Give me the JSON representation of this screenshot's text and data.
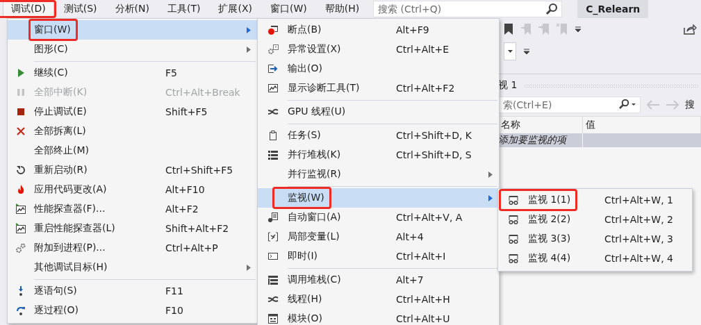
{
  "menubar": {
    "items": [
      {
        "label": "调试(D)",
        "selected": true,
        "annotated": true
      },
      {
        "label": "测试(S)",
        "selected": false,
        "annotated": false
      },
      {
        "label": "分析(N)",
        "selected": false,
        "annotated": false
      },
      {
        "label": "工具(T)",
        "selected": false,
        "annotated": false
      },
      {
        "label": "扩展(X)",
        "selected": false,
        "annotated": false
      },
      {
        "label": "窗口(W)",
        "selected": false,
        "annotated": false
      },
      {
        "label": "帮助(H)",
        "selected": false,
        "annotated": false
      }
    ],
    "search": {
      "placeholder": "搜索 (Ctrl+Q)"
    },
    "solution": "C_Relearn"
  },
  "watch_panel": {
    "title": "视 1",
    "search": {
      "placeholder": "索(Ctrl+E)"
    },
    "search_depth_label": "搜",
    "columns": [
      "名称",
      "值"
    ],
    "rows": [
      {
        "name": "添加要监视的项"
      }
    ]
  },
  "debug_menu": {
    "items": [
      {
        "kind": "item",
        "label": "窗口(W)",
        "has_submenu": true,
        "selected": true,
        "disabled": false,
        "annotated": true
      },
      {
        "kind": "item",
        "label": "图形(C)",
        "has_submenu": true,
        "selected": false,
        "disabled": false,
        "annotated": false
      },
      {
        "kind": "separator"
      },
      {
        "kind": "item",
        "label": "继续(C)",
        "shortcut": "F5",
        "has_submenu": false,
        "selected": false,
        "disabled": false,
        "annotated": false
      },
      {
        "kind": "item",
        "label": "全部中断(K)",
        "shortcut": "Ctrl+Alt+Break",
        "has_submenu": false,
        "selected": false,
        "disabled": true,
        "annotated": false
      },
      {
        "kind": "item",
        "label": "停止调试(E)",
        "shortcut": "Shift+F5",
        "has_submenu": false,
        "selected": false,
        "disabled": false,
        "annotated": false
      },
      {
        "kind": "item",
        "label": "全部拆离(L)",
        "has_submenu": false,
        "selected": false,
        "disabled": false,
        "annotated": false
      },
      {
        "kind": "item",
        "label": "全部终止(M)",
        "has_submenu": false,
        "selected": false,
        "disabled": false,
        "annotated": false
      },
      {
        "kind": "item",
        "label": "重新启动(R)",
        "shortcut": "Ctrl+Shift+F5",
        "has_submenu": false,
        "selected": false,
        "disabled": false,
        "annotated": false
      },
      {
        "kind": "item",
        "label": "应用代码更改(A)",
        "shortcut": "Alt+F10",
        "has_submenu": false,
        "selected": false,
        "disabled": false,
        "annotated": false
      },
      {
        "kind": "item",
        "label": "性能探查器(F)...",
        "shortcut": "Alt+F2",
        "has_submenu": false,
        "selected": false,
        "disabled": false,
        "annotated": false
      },
      {
        "kind": "item",
        "label": "重启性能探查器(L)",
        "shortcut": "Shift+Alt+F2",
        "has_submenu": false,
        "selected": false,
        "disabled": false,
        "annotated": false
      },
      {
        "kind": "item",
        "label": "附加到进程(P)...",
        "shortcut": "Ctrl+Alt+P",
        "has_submenu": false,
        "selected": false,
        "disabled": false,
        "annotated": false
      },
      {
        "kind": "item",
        "label": "其他调试目标(H)",
        "has_submenu": true,
        "selected": false,
        "disabled": false,
        "annotated": false
      },
      {
        "kind": "separator"
      },
      {
        "kind": "item",
        "label": "逐语句(S)",
        "shortcut": "F11",
        "has_submenu": false,
        "selected": false,
        "disabled": false,
        "annotated": false
      },
      {
        "kind": "item",
        "label": "逐过程(O)",
        "shortcut": "F10",
        "has_submenu": false,
        "selected": false,
        "disabled": false,
        "annotated": false
      }
    ]
  },
  "window_menu": {
    "items": [
      {
        "kind": "item",
        "label": "断点(B)",
        "shortcut": "Alt+F9",
        "has_submenu": false,
        "selected": false,
        "disabled": false,
        "annotated": false
      },
      {
        "kind": "item",
        "label": "异常设置(X)",
        "shortcut": "Ctrl+Alt+E",
        "has_submenu": false,
        "selected": false,
        "disabled": false,
        "annotated": false
      },
      {
        "kind": "item",
        "label": "输出(O)",
        "has_submenu": false,
        "selected": false,
        "disabled": false,
        "annotated": false
      },
      {
        "kind": "item",
        "label": "显示诊断工具(T)",
        "shortcut": "Ctrl+Alt+F2",
        "has_submenu": false,
        "selected": false,
        "disabled": false,
        "annotated": false
      },
      {
        "kind": "separator"
      },
      {
        "kind": "item",
        "label": "GPU 线程(U)",
        "has_submenu": false,
        "selected": false,
        "disabled": false,
        "annotated": false
      },
      {
        "kind": "separator"
      },
      {
        "kind": "item",
        "label": "任务(S)",
        "shortcut": "Ctrl+Shift+D, K",
        "has_submenu": false,
        "selected": false,
        "disabled": false,
        "annotated": false
      },
      {
        "kind": "item",
        "label": "并行堆栈(K)",
        "shortcut": "Ctrl+Shift+D, S",
        "has_submenu": false,
        "selected": false,
        "disabled": false,
        "annotated": false
      },
      {
        "kind": "item",
        "label": "并行监视(R)",
        "has_submenu": true,
        "selected": false,
        "disabled": false,
        "annotated": false
      },
      {
        "kind": "separator"
      },
      {
        "kind": "item",
        "label": "监视(W)",
        "has_submenu": true,
        "selected": true,
        "disabled": false,
        "annotated": true
      },
      {
        "kind": "item",
        "label": "自动窗口(A)",
        "shortcut": "Ctrl+Alt+V, A",
        "has_submenu": false,
        "selected": false,
        "disabled": false,
        "annotated": false
      },
      {
        "kind": "item",
        "label": "局部变量(L)",
        "shortcut": "Alt+4",
        "has_submenu": false,
        "selected": false,
        "disabled": false,
        "annotated": false
      },
      {
        "kind": "item",
        "label": "即时(I)",
        "shortcut": "Ctrl+Alt+I",
        "has_submenu": false,
        "selected": false,
        "disabled": false,
        "annotated": false
      },
      {
        "kind": "separator"
      },
      {
        "kind": "item",
        "label": "调用堆栈(C)",
        "shortcut": "Alt+7",
        "has_submenu": false,
        "selected": false,
        "disabled": false,
        "annotated": false
      },
      {
        "kind": "item",
        "label": "线程(H)",
        "shortcut": "Ctrl+Alt+H",
        "has_submenu": false,
        "selected": false,
        "disabled": false,
        "annotated": false
      },
      {
        "kind": "item",
        "label": "模块(O)",
        "shortcut": "Ctrl+Alt+U",
        "has_submenu": false,
        "selected": false,
        "disabled": false,
        "annotated": false
      }
    ]
  },
  "watch_menu": {
    "items": [
      {
        "kind": "item",
        "label": "监视 1(1)",
        "shortcut": "Ctrl+Alt+W, 1",
        "has_submenu": false,
        "selected": false,
        "disabled": false,
        "annotated": true
      },
      {
        "kind": "item",
        "label": "监视 2(2)",
        "shortcut": "Ctrl+Alt+W, 2",
        "has_submenu": false,
        "selected": false,
        "disabled": false,
        "annotated": false
      },
      {
        "kind": "item",
        "label": "监视 3(3)",
        "shortcut": "Ctrl+Alt+W, 3",
        "has_submenu": false,
        "selected": false,
        "disabled": false,
        "annotated": false
      },
      {
        "kind": "item",
        "label": "监视 4(4)",
        "shortcut": "Ctrl+Alt+W, 4",
        "has_submenu": false,
        "selected": false,
        "disabled": false,
        "annotated": false
      }
    ]
  }
}
